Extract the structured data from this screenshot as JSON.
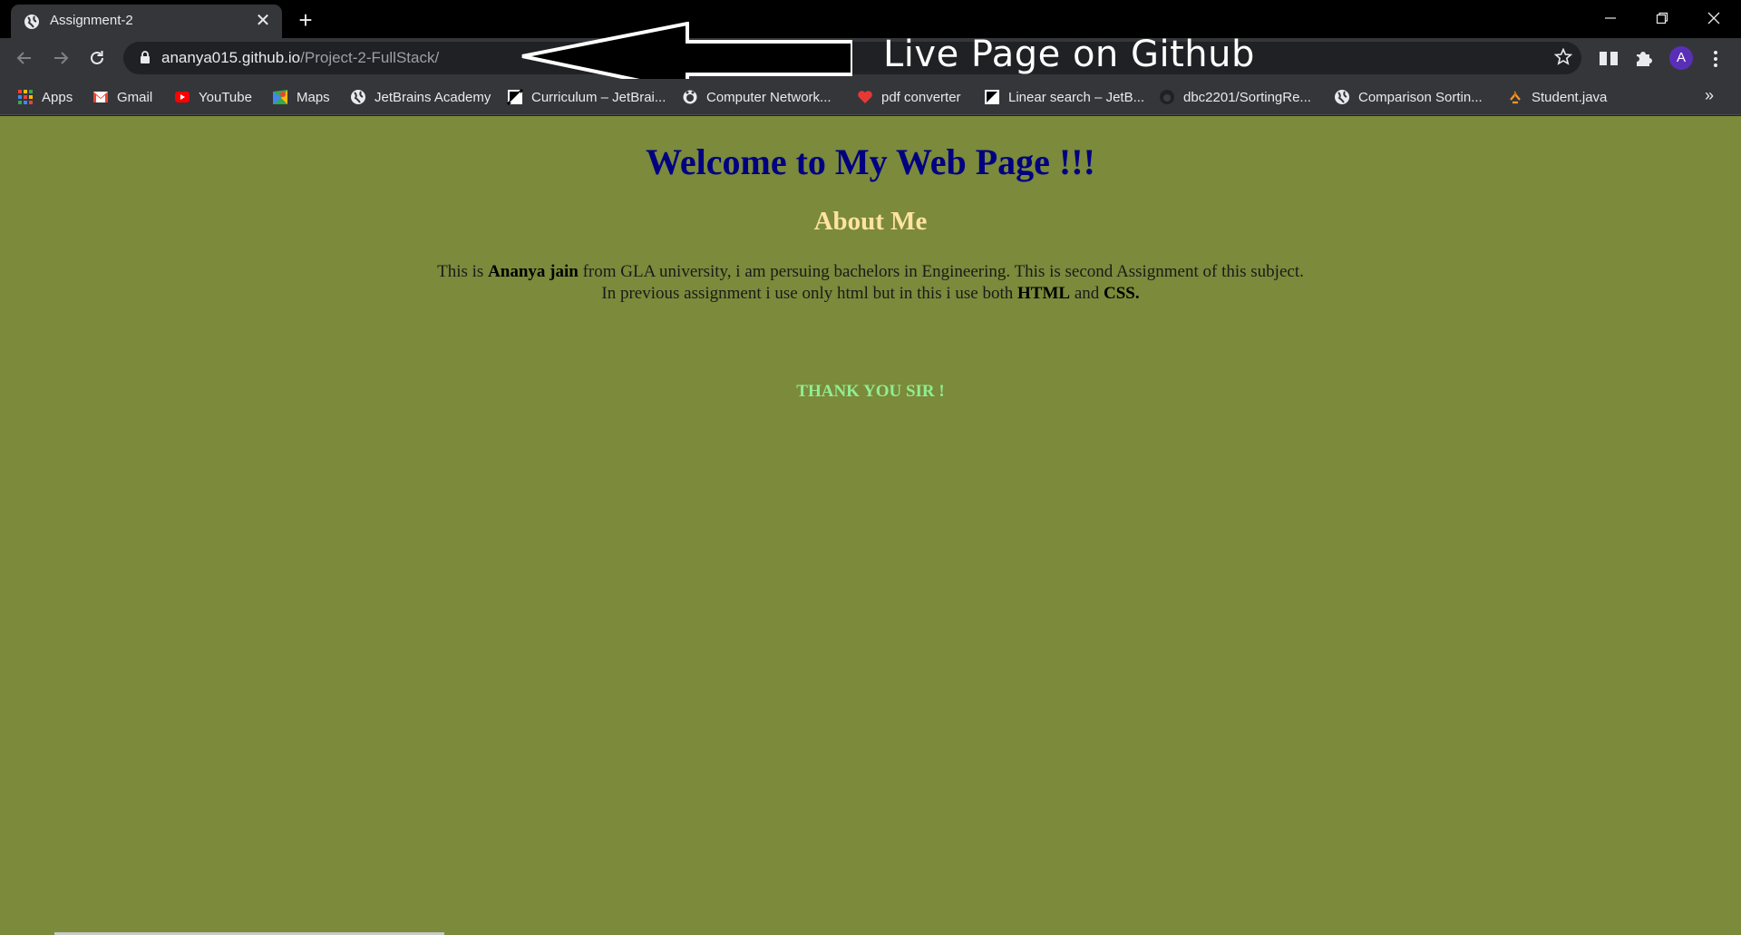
{
  "browser": {
    "tab": {
      "title": "Assignment-2",
      "close": "✕"
    },
    "new_tab": "+",
    "url": {
      "host": "ananya015.github.io",
      "path": "/Project-2-FullStack/"
    },
    "profile_initial": "A",
    "more_bookmarks": "»"
  },
  "bookmarks": [
    {
      "label": "Apps",
      "icon": "apps-grid-icon"
    },
    {
      "label": "Gmail",
      "icon": "gmail-icon"
    },
    {
      "label": "YouTube",
      "icon": "youtube-icon"
    },
    {
      "label": "Maps",
      "icon": "maps-icon"
    },
    {
      "label": "JetBrains Academy",
      "icon": "globe-icon"
    },
    {
      "label": "Curriculum – JetBrai...",
      "icon": "jetbrains-icon"
    },
    {
      "label": "Computer Network...",
      "icon": "github-icon"
    },
    {
      "label": "pdf converter",
      "icon": "heart-icon"
    },
    {
      "label": "Linear search – JetB...",
      "icon": "jetbrains-icon"
    },
    {
      "label": "dbc2201/SortingRe...",
      "icon": "github-icon"
    },
    {
      "label": "Comparison Sortin...",
      "icon": "globe-icon"
    },
    {
      "label": "Student.java",
      "icon": "java-icon"
    }
  ],
  "annotation": {
    "text": "Live Page on Github"
  },
  "page": {
    "heading": "Welcome to My Web Page !!!",
    "subheading": "About Me",
    "about": {
      "p1_a": "This is ",
      "name": "Ananya jain",
      "p1_b": " from GLA university, i am persuing bachelors in Engineering. This is second Assignment of this subject.",
      "p2_a": "In previous assignment i use only html but in this i use both ",
      "html": "HTML",
      "p2_b": " and ",
      "css": "CSS."
    },
    "thanks": "THANK YOU SIR !"
  },
  "colors": {
    "page_bg": "#7b8a3b",
    "heading": "#000080",
    "subheading": "#ffe4a0",
    "thanks": "#90ee90",
    "avatar": "#5a2fb8"
  }
}
